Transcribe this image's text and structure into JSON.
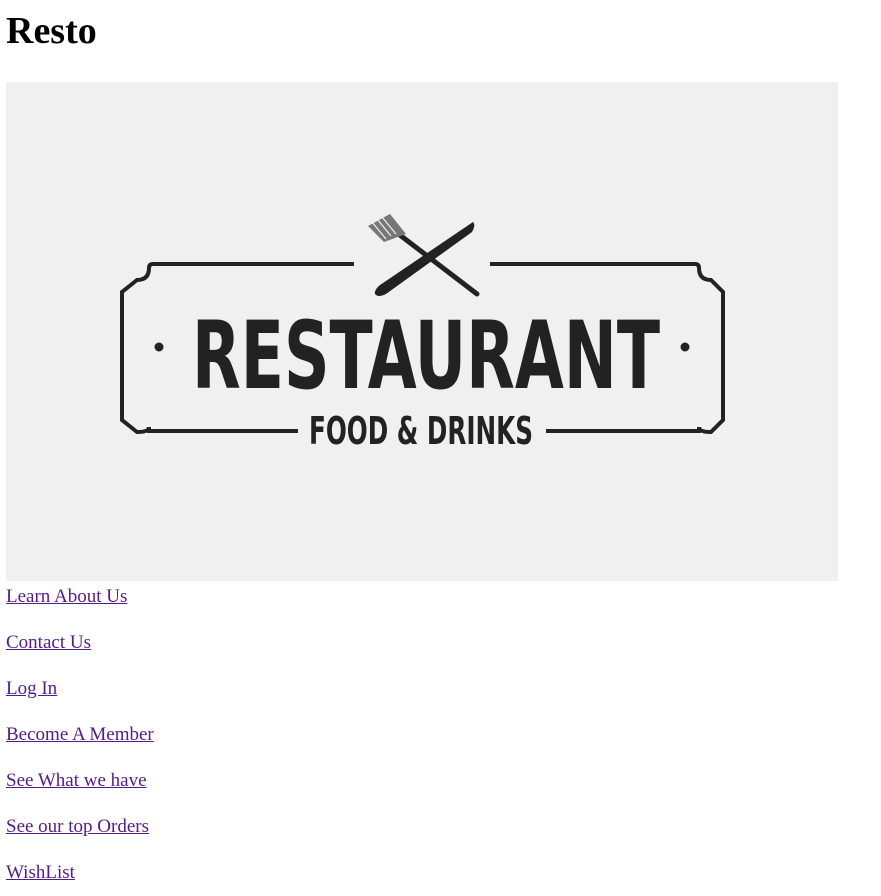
{
  "page": {
    "title": "Resto"
  },
  "logo": {
    "main_text": "RESTAURANT",
    "sub_text": "FOOD & DRINKS",
    "background": "#f0f0f0",
    "ink": "#222222"
  },
  "nav": {
    "link_color": "#551a8b",
    "links": [
      {
        "label": "Learn About Us"
      },
      {
        "label": "Contact Us"
      },
      {
        "label": "Log In"
      },
      {
        "label": "Become A Member"
      },
      {
        "label": "See What we have"
      },
      {
        "label": "See our top Orders"
      },
      {
        "label": "WishList"
      }
    ]
  }
}
